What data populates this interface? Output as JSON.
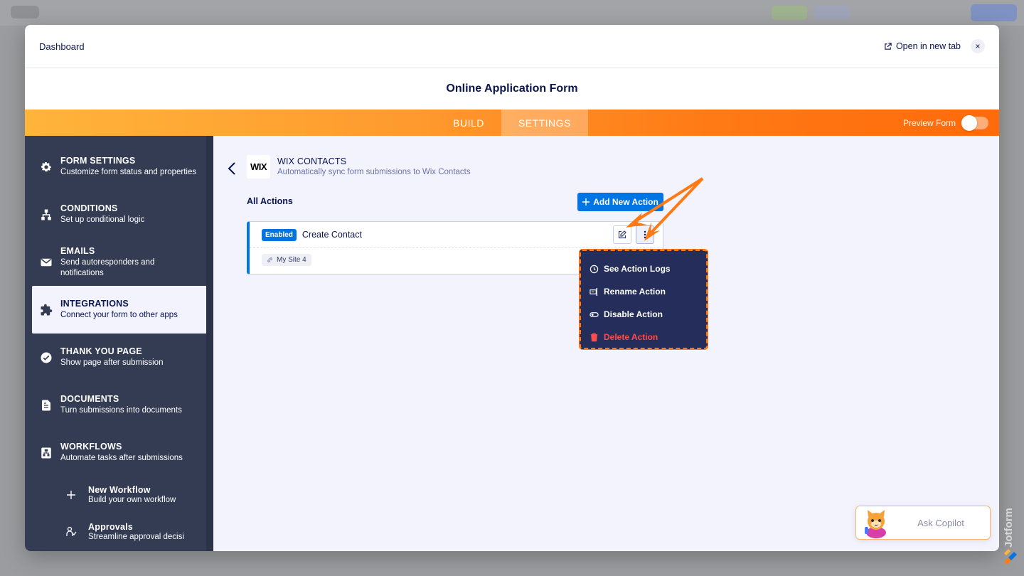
{
  "modal": {
    "title": "Dashboard",
    "open_new_tab": "Open in new tab",
    "close": "×"
  },
  "form": {
    "title": "Online Application Form"
  },
  "tabs": [
    {
      "label": "BUILD",
      "active": false
    },
    {
      "label": "SETTINGS",
      "active": true
    }
  ],
  "preview_label": "Preview Form",
  "sidebar": {
    "items": [
      {
        "title": "FORM SETTINGS",
        "subtitle": "Customize form status and properties",
        "icon": "gear-icon"
      },
      {
        "title": "CONDITIONS",
        "subtitle": "Set up conditional logic",
        "icon": "conditions-icon"
      },
      {
        "title": "EMAILS",
        "subtitle": "Send autoresponders and notifications",
        "icon": "mail-icon"
      },
      {
        "title": "INTEGRATIONS",
        "subtitle": "Connect your form to other apps",
        "icon": "puzzle-icon"
      },
      {
        "title": "THANK YOU PAGE",
        "subtitle": "Show page after submission",
        "icon": "check-circle-icon"
      },
      {
        "title": "DOCUMENTS",
        "subtitle": "Turn submissions into documents",
        "icon": "document-icon"
      },
      {
        "title": "WORKFLOWS",
        "subtitle": "Automate tasks after submissions",
        "icon": "workflow-icon"
      }
    ],
    "sub_items": [
      {
        "title": "New Workflow",
        "subtitle": "Build your own workflow",
        "icon": "plus-icon"
      },
      {
        "title": "Approvals",
        "subtitle": "Streamline approval decisi",
        "icon": "approvals-icon"
      }
    ]
  },
  "integration": {
    "logo": "WIX",
    "name": "WIX CONTACTS",
    "description": "Automatically sync form submissions to Wix Contacts"
  },
  "actions": {
    "heading": "All Actions",
    "add_button": "Add New Action",
    "items": [
      {
        "status": "Enabled",
        "name": "Create Contact",
        "site": "My Site 4"
      }
    ]
  },
  "dropdown": [
    {
      "label": "See Action Logs",
      "icon": "history-icon",
      "danger": false
    },
    {
      "label": "Rename Action",
      "icon": "rename-icon",
      "danger": false
    },
    {
      "label": "Disable Action",
      "icon": "toggle-icon",
      "danger": false
    },
    {
      "label": "Delete Action",
      "icon": "trash-icon",
      "danger": true
    }
  ],
  "copilot": {
    "label": "Ask Copilot"
  },
  "brand": {
    "name": "Jotform"
  },
  "colors": {
    "accent_blue": "#0075e3",
    "navy": "#0a1551",
    "sidebar": "#343c54",
    "orange": "#ff7a15",
    "danger": "#ff4d4d"
  }
}
